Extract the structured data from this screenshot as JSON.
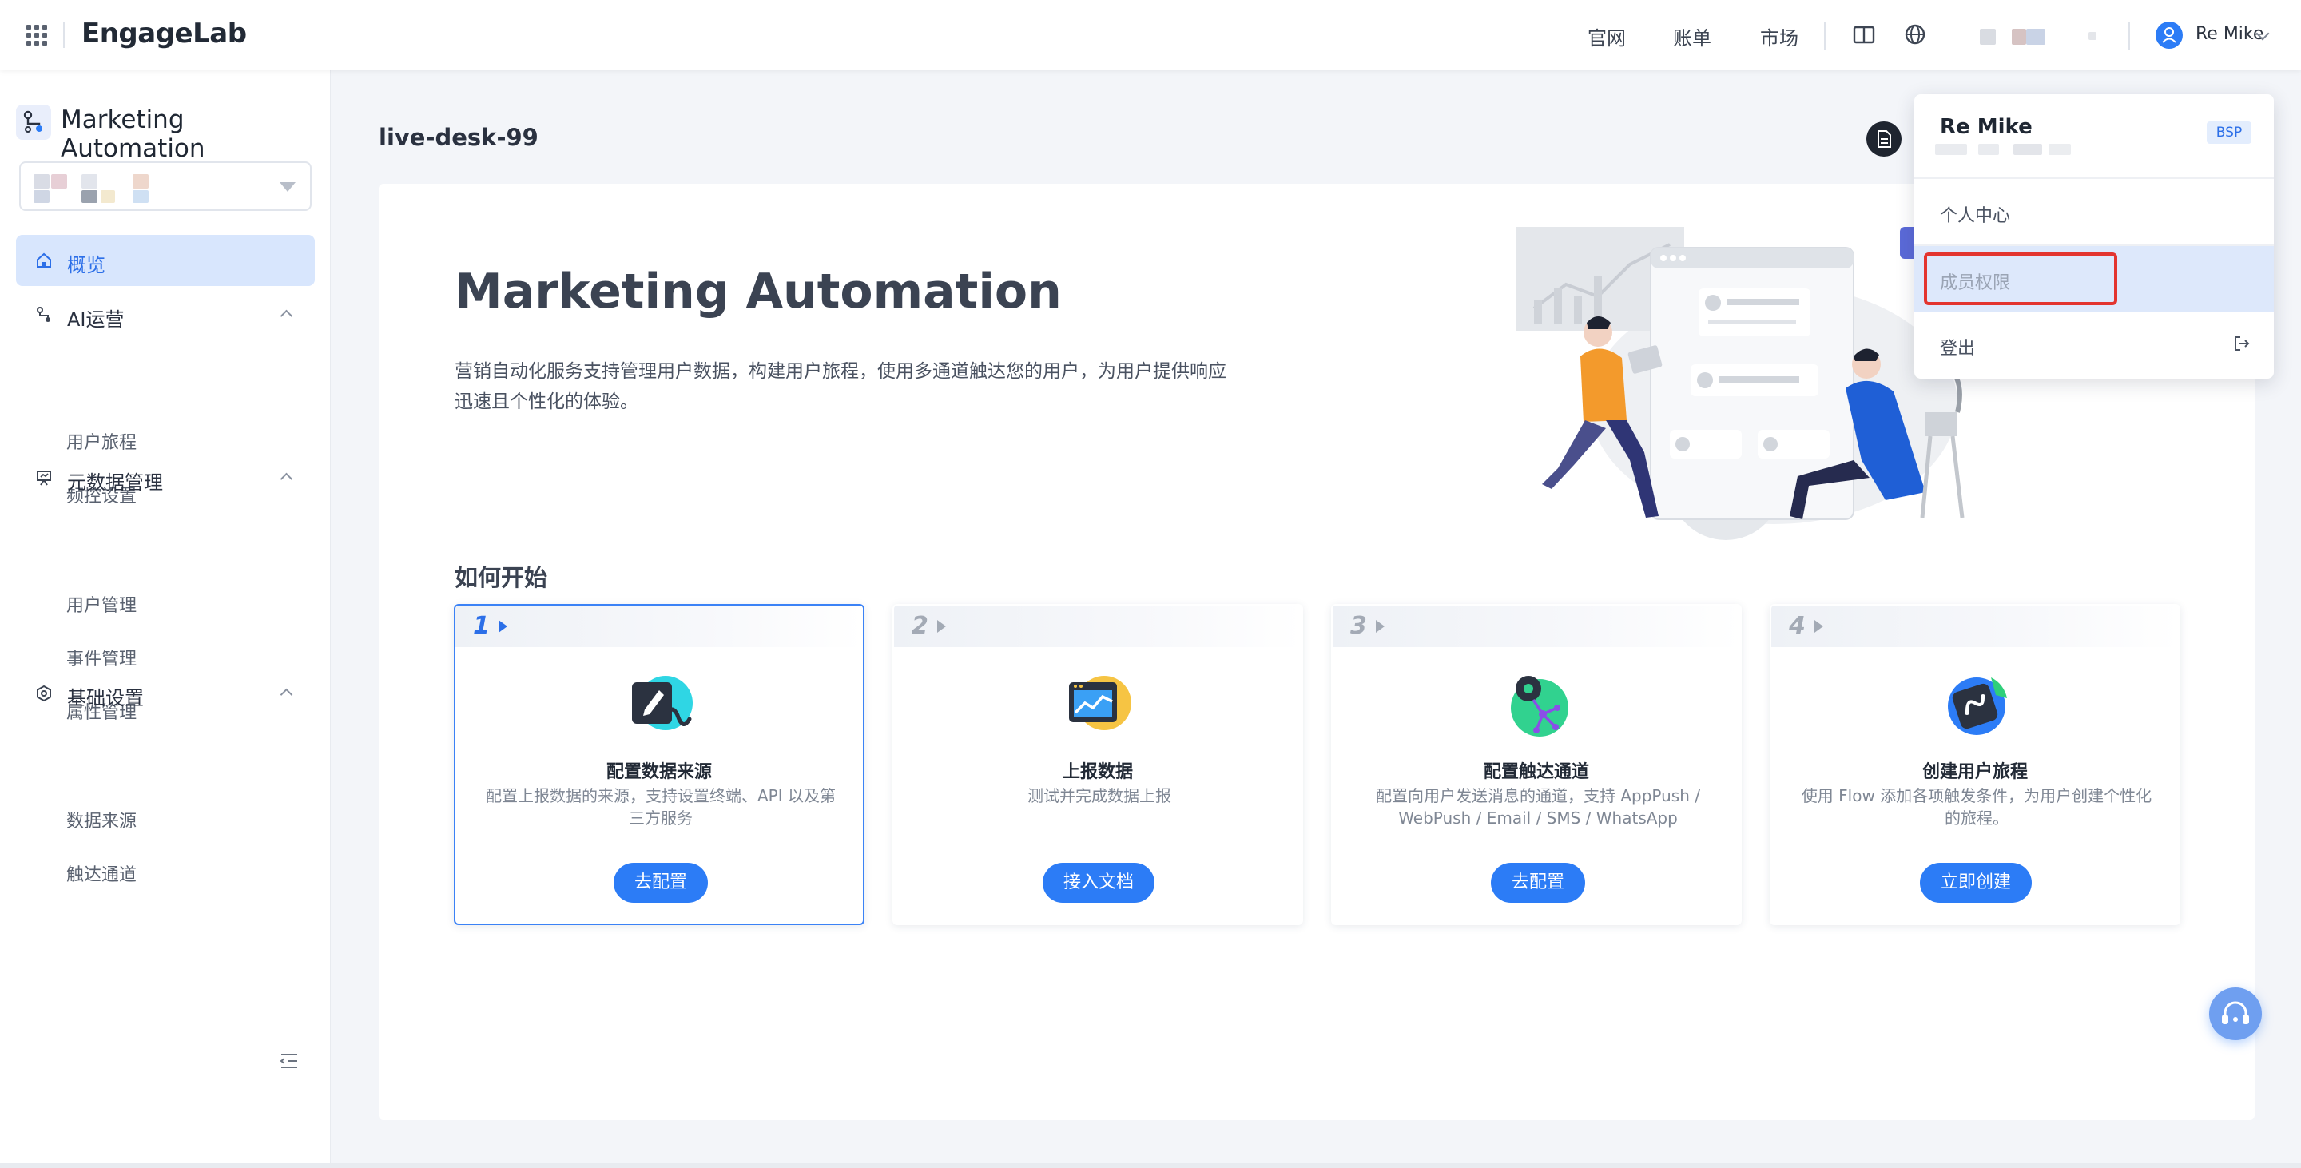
{
  "topbar": {
    "logo": "EngageLab",
    "nav": [
      "官网",
      "账单",
      "市场"
    ],
    "user_name": "Re Mike"
  },
  "sidebar": {
    "app_title": "Marketing Automation",
    "items": [
      {
        "label": "概览",
        "active": true
      },
      {
        "label": "AI运营",
        "children": [
          "用户旅程",
          "频控设置"
        ]
      },
      {
        "label": "元数据管理",
        "children": [
          "用户管理",
          "事件管理",
          "属性管理"
        ]
      },
      {
        "label": "基础设置",
        "children": [
          "数据来源",
          "触达通道"
        ]
      }
    ]
  },
  "main": {
    "project_name": "live-desk-99",
    "hero_title": "Marketing Automation",
    "hero_desc": "营销自动化服务支持管理用户数据，构建用户旅程，使用多通道触达您的用户，为用户提供响应迅速且个性化的体验。",
    "section_title": "如何开始",
    "steps": [
      {
        "num": "1",
        "title": "配置数据来源",
        "desc": "配置上报数据的来源，支持设置终端、API 以及第三方服务",
        "button": "去配置"
      },
      {
        "num": "2",
        "title": "上报数据",
        "desc": "测试并完成数据上报",
        "button": "接入文档"
      },
      {
        "num": "3",
        "title": "配置触达通道",
        "desc": "配置向用户发送消息的通道，支持 AppPush / WebPush / Email / SMS / WhatsApp",
        "button": "去配置"
      },
      {
        "num": "4",
        "title": "创建用户旅程",
        "desc": "使用 Flow 添加各项触发条件，为用户创建个性化的旅程。",
        "button": "立即创建"
      }
    ]
  },
  "dropdown": {
    "name": "Re Mike",
    "badge": "BSP",
    "items": [
      "个人中心",
      "成员权限",
      "登出"
    ]
  },
  "colors": {
    "accent": "#2c7cf6",
    "highlight_row": "#dde8fb",
    "annotation_red": "#e3342f"
  }
}
